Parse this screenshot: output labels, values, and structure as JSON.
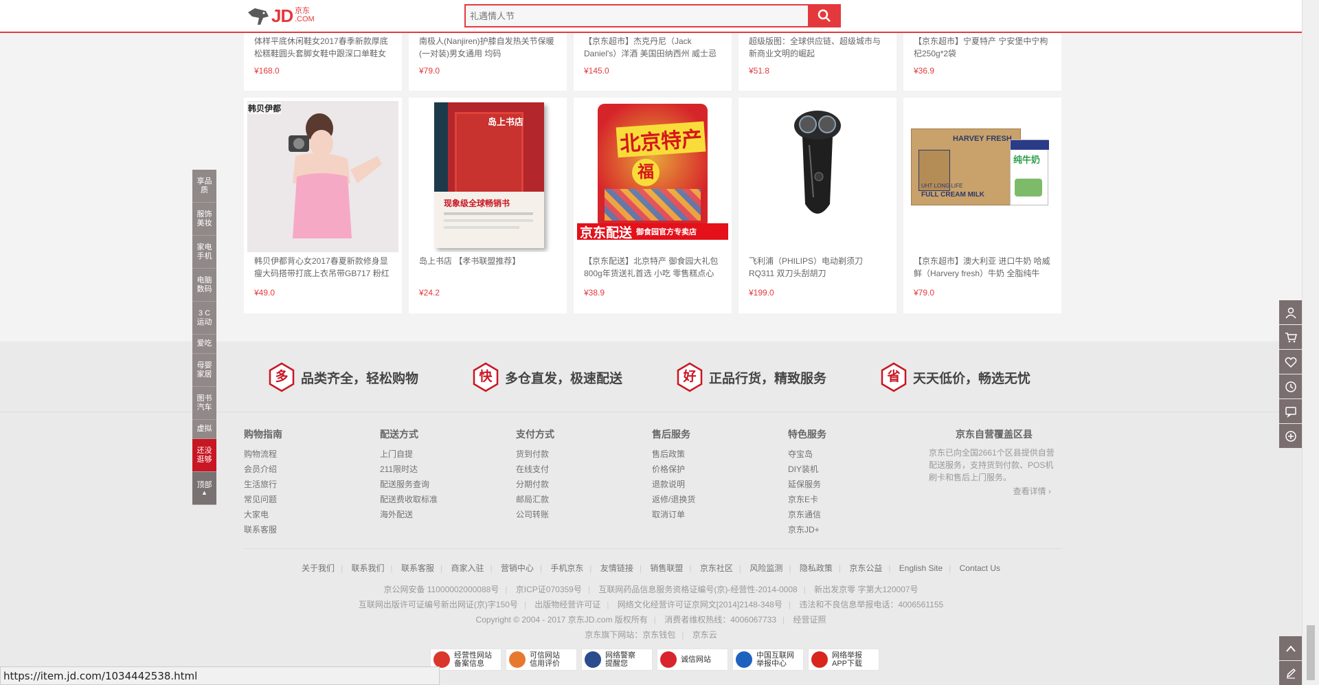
{
  "header": {
    "logo_text": "JD",
    "logo_sub": "京东\n.COM",
    "search_placeholder": "礼遇情人节"
  },
  "products_row1": [
    {
      "name": "体样平底休闲鞋女2017春季新款厚底松糕鞋圆头套脚女鞋中跟深口单鞋女",
      "price": "¥168.0"
    },
    {
      "name": "南极人(Nanjiren)护膝自发热关节保暖(一对装)男女通用 均码",
      "price": "¥79.0"
    },
    {
      "name": "【京东超市】杰克丹尼（Jack Daniel's）洋酒 美国田纳西州 威士忌",
      "price": "¥145.0"
    },
    {
      "name": "超级版图：全球供应链、超级城市与新商业文明的崛起",
      "price": "¥51.8"
    },
    {
      "name": "【京东超市】宁夏特产 宁安堡中宁枸杞250g*2袋",
      "price": "¥36.9"
    }
  ],
  "products_row2": [
    {
      "name": "韩贝伊都背心女2017春夏新款修身显瘦大码搭带打底上衣吊带GB717 粉红",
      "price": "¥49.0",
      "brand_overlay": "韩贝伊都"
    },
    {
      "name": "岛上书店 【孝书联盟推荐】",
      "price": "¥24.2",
      "book_title": "岛上书店",
      "book_banner": "现象级全球畅销书"
    },
    {
      "name": "【京东配送】北京特产 御食园大礼包800g年货送礼首选 小吃 零售糕点心",
      "price": "¥38.9",
      "bag_text": "北京特产",
      "bag_banner": "京东配送",
      "bag_banner_sub": "御食园官方专卖店",
      "bag_fu": "福"
    },
    {
      "name": "飞利浦（PHILIPS）电动剃须刀RQ311 双刀头刮胡刀",
      "price": "¥199.0"
    },
    {
      "name": "【京东超市】澳大利亚 进口牛奶 哈威鲜（Harvery fresh）牛奶 全脂纯牛",
      "price": "¥79.0",
      "box_brand": "HARVEY FRESH",
      "box_label": "FULL CREAM MILK",
      "box_sub": "UHT LONG LIFE",
      "carton_text": "纯牛奶"
    }
  ],
  "services": [
    {
      "icon_char": "多",
      "label": "品类齐全，轻松购物"
    },
    {
      "icon_char": "快",
      "label": "多仓直发，极速配送"
    },
    {
      "icon_char": "好",
      "label": "正品行货，精致服务"
    },
    {
      "icon_char": "省",
      "label": "天天低价，畅选无忧"
    }
  ],
  "footer_cols": [
    {
      "title": "购物指南",
      "links": [
        "购物流程",
        "会员介绍",
        "生活旅行",
        "常见问题",
        "大家电",
        "联系客服"
      ]
    },
    {
      "title": "配送方式",
      "links": [
        "上门自提",
        "211限时达",
        "配送服务查询",
        "配送费收取标准",
        "海外配送"
      ]
    },
    {
      "title": "支付方式",
      "links": [
        "货到付款",
        "在线支付",
        "分期付款",
        "邮局汇款",
        "公司转账"
      ]
    },
    {
      "title": "售后服务",
      "links": [
        "售后政策",
        "价格保护",
        "退款说明",
        "返修/退换货",
        "取消订单"
      ]
    },
    {
      "title": "特色服务",
      "links": [
        "夺宝岛",
        "DIY装机",
        "延保服务",
        "京东E卡",
        "京东通信",
        "京东JD+"
      ]
    }
  ],
  "coverage": {
    "title": "京东自营覆盖区县",
    "text": "京东已向全国2661个区县提供自营配送服务，支持货到付款、POS机刷卡和售后上门服务。",
    "more": "查看详情 ›"
  },
  "bottom_links": [
    "关于我们",
    "联系我们",
    "联系客服",
    "商家入驻",
    "营销中心",
    "手机京东",
    "友情链接",
    "销售联盟",
    "京东社区",
    "风险监测",
    "隐私政策",
    "京东公益",
    "English Site",
    "Contact Us"
  ],
  "legal_lines": [
    [
      "京公网安备 11000002000088号",
      "京ICP证070359号",
      "互联网药品信息服务资格证编号(京)-经营性-2014-0008",
      "新出发京零 字第大120007号"
    ],
    [
      "互联网出版许可证编号新出网证(京)字150号",
      "出版物经营许可证",
      "网络文化经营许可证京网文[2014]2148-348号",
      "违法和不良信息举报电话：4006561155"
    ],
    [
      "Copyright © 2004 - 2017  京东JD.com 版权所有",
      "消费者维权热线：4006067733",
      "经营证照"
    ],
    [
      "京东旗下网站：京东钱包",
      "京东云"
    ]
  ],
  "badges": [
    {
      "text": "经营性网站\n备案信息",
      "color": "#d9372b"
    },
    {
      "text": "可信网站\n信用评价",
      "color": "#e7792f"
    },
    {
      "text": "网络警察\n提醒您",
      "color": "#2b4c8c"
    },
    {
      "text": "诚信网站",
      "color": "#d8242c"
    },
    {
      "text": "中国互联网\n举报中心",
      "color": "#1e62c0"
    },
    {
      "text": "网络举报\nAPP下载",
      "color": "#d9261c"
    }
  ],
  "elevator": [
    {
      "label": "享品\n质"
    },
    {
      "label": "服饰\n美妆"
    },
    {
      "label": "家电\n手机"
    },
    {
      "label": "电脑\n数码"
    },
    {
      "label": "3 C\n运动"
    },
    {
      "label": "爱吃"
    },
    {
      "label": "母婴\n家居"
    },
    {
      "label": "图书\n汽车"
    },
    {
      "label": "虚拟"
    },
    {
      "label": "还没\n逛够"
    },
    {
      "label": "顶部"
    }
  ],
  "status_url": "https://item.jd.com/1034442538.html"
}
